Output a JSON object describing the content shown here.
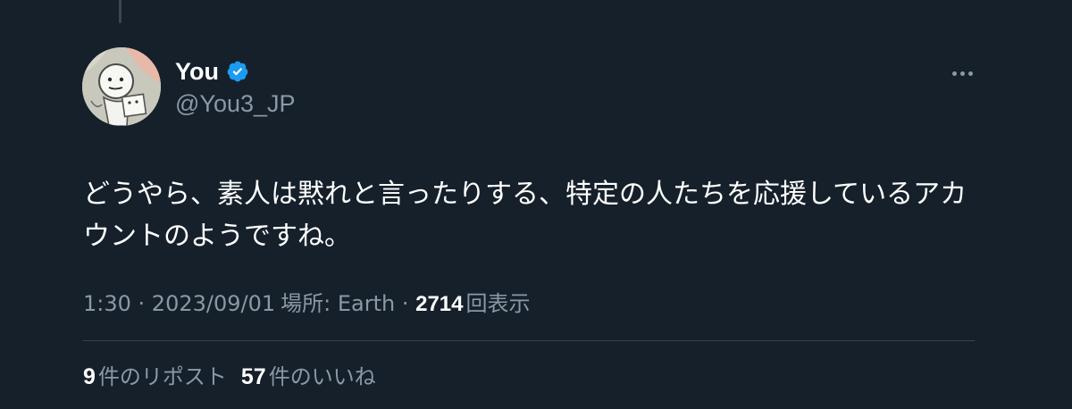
{
  "tweet": {
    "author": {
      "display_name": "You",
      "handle": "@You3_JP",
      "verified": true,
      "verified_color": "#1d9bf0"
    },
    "text": "どうやら、素人は黙れと言ったりする、特定の人たちを応援しているアカ\nウントのようですね。",
    "meta": {
      "time": "1:30",
      "separator": " · ",
      "date": "2023/09/01",
      "location_label": "場所: Earth",
      "separator2": " · ",
      "views_count": "2714",
      "views_label": "回表示"
    },
    "stats": {
      "reposts_count": "9",
      "reposts_label": "件のリポスト",
      "likes_count": "57",
      "likes_label": "件のいいね"
    },
    "more_icon": "more-horizontal-icon"
  },
  "colors": {
    "background": "#15202b",
    "primary_text": "#ffffff",
    "secondary_text": "#8b98a5",
    "divider": "#38444d"
  }
}
